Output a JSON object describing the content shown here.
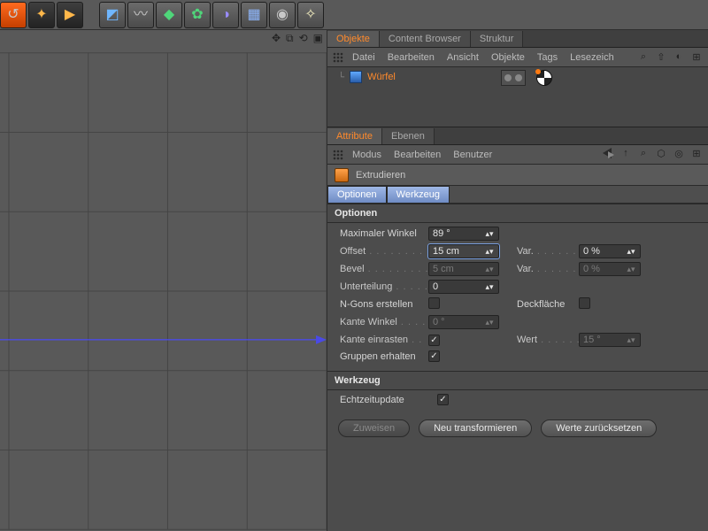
{
  "object_manager": {
    "tabs": [
      "Objekte",
      "Content Browser",
      "Struktur"
    ],
    "active_tab": 0,
    "menu": [
      "Datei",
      "Bearbeiten",
      "Ansicht",
      "Objekte",
      "Tags",
      "Lesezeich"
    ],
    "object_name": "Würfel"
  },
  "attribute_manager": {
    "tabs": [
      "Attribute",
      "Ebenen"
    ],
    "active_tab": 0,
    "menu": [
      "Modus",
      "Bearbeiten",
      "Benutzer"
    ],
    "tool_name": "Extrudieren",
    "tool_tabs": [
      "Optionen",
      "Werkzeug"
    ],
    "sections": {
      "optionen": {
        "title": "Optionen",
        "max_angle_label": "Maximaler Winkel",
        "max_angle_value": "89 °",
        "offset_label": "Offset",
        "offset_value": "15 cm",
        "offset_var_label": "Var.",
        "offset_var_value": "0 %",
        "bevel_label": "Bevel",
        "bevel_value": "5 cm",
        "bevel_var_label": "Var.",
        "bevel_var_value": "0 %",
        "subdiv_label": "Unterteilung",
        "subdiv_value": "0",
        "ngons_label": "N-Gons erstellen",
        "ngons_checked": false,
        "caps_label": "Deckfläche",
        "caps_checked": false,
        "edge_angle_label": "Kante Winkel",
        "edge_angle_value": "0 °",
        "edge_snap_label": "Kante einrasten",
        "edge_snap_checked": true,
        "wert_label": "Wert",
        "wert_value": "15 °",
        "keep_groups_label": "Gruppen erhalten",
        "keep_groups_checked": true
      },
      "werkzeug": {
        "title": "Werkzeug",
        "realtime_label": "Echtzeitupdate",
        "realtime_checked": true,
        "btn_apply": "Zuweisen",
        "btn_new": "Neu transformieren",
        "btn_reset": "Werte zurücksetzen"
      }
    }
  }
}
